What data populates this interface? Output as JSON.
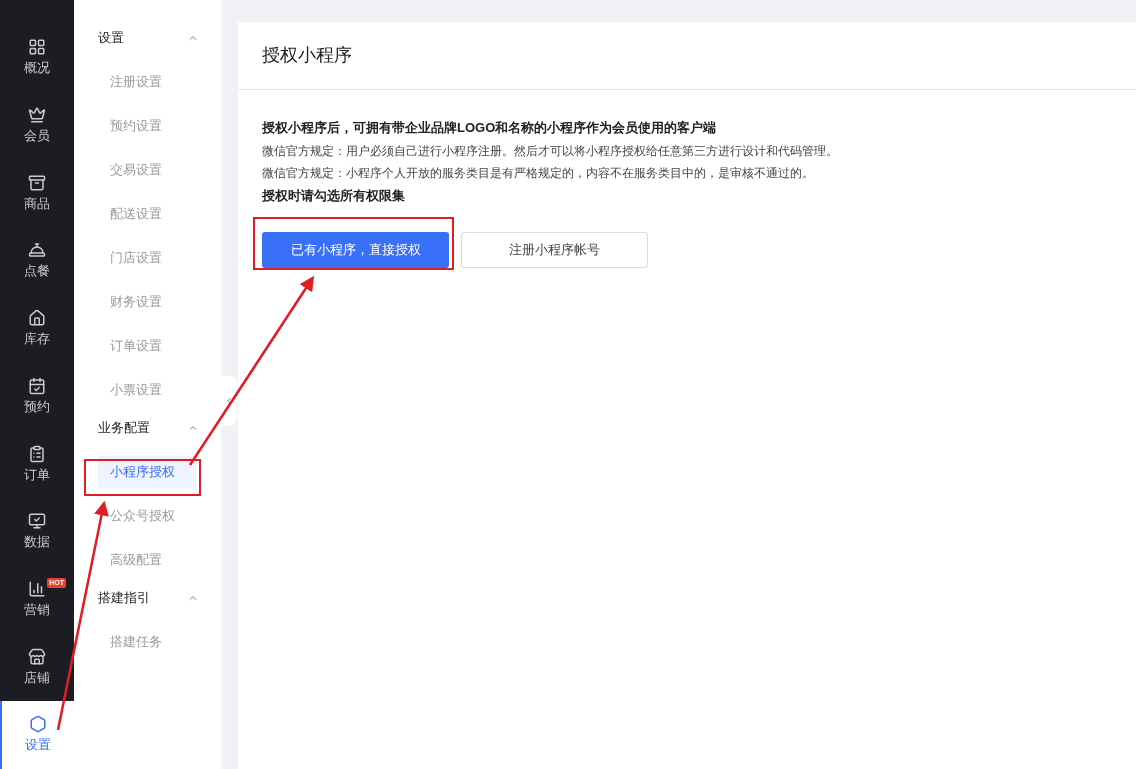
{
  "rail": [
    {
      "label": "概况",
      "selected": false
    },
    {
      "label": "会员",
      "selected": false
    },
    {
      "label": "商品",
      "selected": false
    },
    {
      "label": "点餐",
      "selected": false
    },
    {
      "label": "库存",
      "selected": false
    },
    {
      "label": "预约",
      "selected": false
    },
    {
      "label": "订单",
      "selected": false
    },
    {
      "label": "数据",
      "selected": false
    },
    {
      "label": "营销",
      "selected": false,
      "badge": "HOT"
    },
    {
      "label": "店铺",
      "selected": false
    },
    {
      "label": "设置",
      "selected": true
    }
  ],
  "menu": [
    {
      "title": "设置",
      "expanded": true,
      "items": [
        {
          "label": "注册设置",
          "selected": false
        },
        {
          "label": "预约设置",
          "selected": false
        },
        {
          "label": "交易设置",
          "selected": false
        },
        {
          "label": "配送设置",
          "selected": false
        },
        {
          "label": "门店设置",
          "selected": false
        },
        {
          "label": "财务设置",
          "selected": false
        },
        {
          "label": "订单设置",
          "selected": false
        },
        {
          "label": "小票设置",
          "selected": false
        }
      ]
    },
    {
      "title": "业务配置",
      "expanded": true,
      "items": [
        {
          "label": "小程序授权",
          "selected": true
        },
        {
          "label": "公众号授权",
          "selected": false
        },
        {
          "label": "高级配置",
          "selected": false
        }
      ]
    },
    {
      "title": "搭建指引",
      "expanded": true,
      "items": [
        {
          "label": "搭建任务",
          "selected": false
        }
      ]
    }
  ],
  "page": {
    "title": "授权小程序",
    "lines": [
      {
        "kind": "heading",
        "text": "授权小程序后，可拥有带企业品牌LOGO和名称的小程序作为会员使用的客户端"
      },
      {
        "kind": "note",
        "text": "微信官方规定：用户必须自己进行小程序注册。然后才可以将小程序授权给任意第三方进行设计和代码管理。"
      },
      {
        "kind": "note",
        "text": "微信官方规定：小程序个人开放的服务类目是有严格规定的，内容不在服务类目中的，是审核不通过的。"
      },
      {
        "kind": "heading",
        "text": "授权时请勾选所有权限集"
      }
    ],
    "buttons": [
      {
        "label": "已有小程序，直接授权",
        "kind": "primary"
      },
      {
        "label": "注册小程序帐号",
        "kind": "secondary"
      }
    ]
  }
}
